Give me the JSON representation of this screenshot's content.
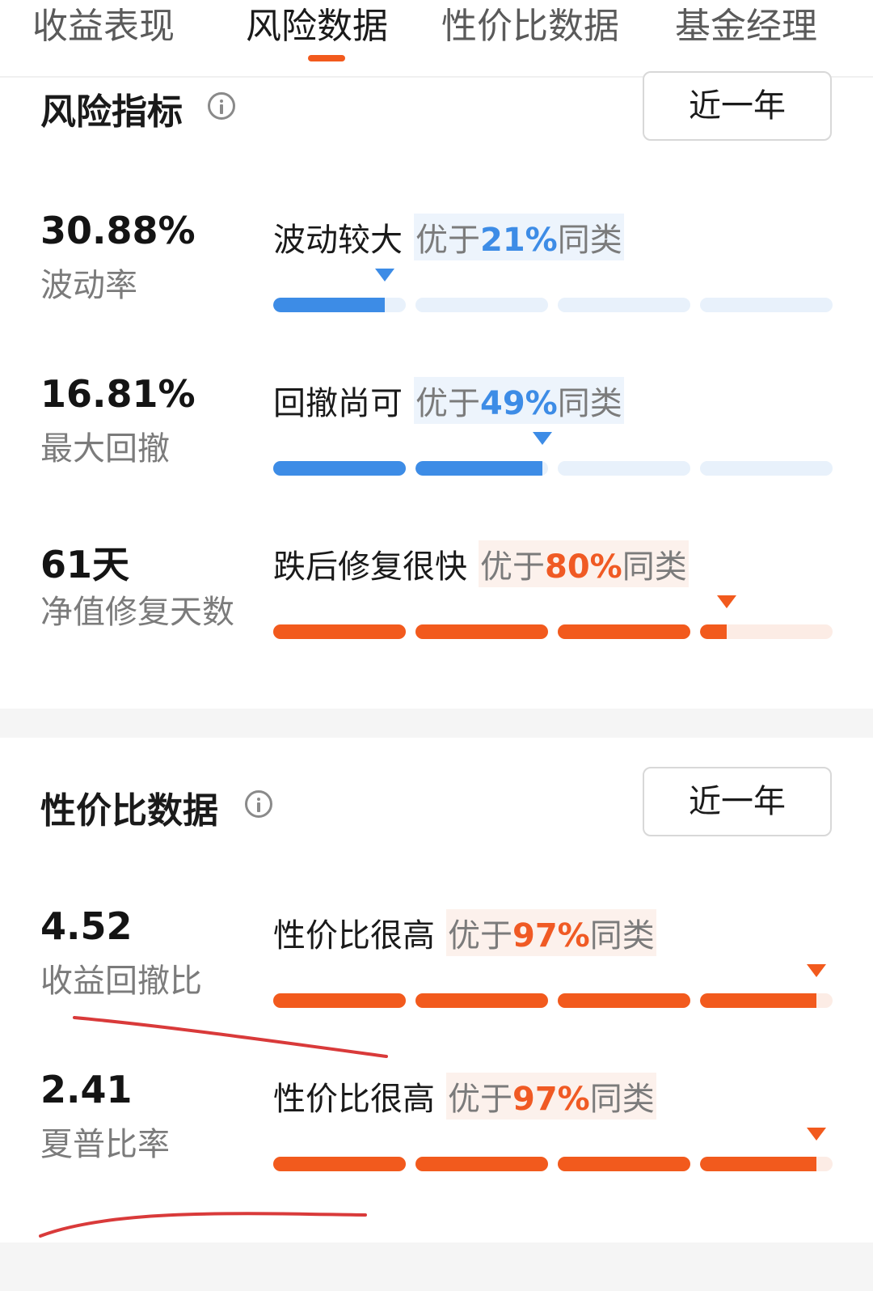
{
  "tabs": [
    {
      "label": "收益表现",
      "active": false
    },
    {
      "label": "风险数据",
      "active": true
    },
    {
      "label": "性价比数据",
      "active": false
    },
    {
      "label": "基金经理",
      "active": false
    }
  ],
  "colors": {
    "accent": "#f25a1d",
    "blue_fill": "#3d8ce6",
    "blue_track": "#e8f1fb",
    "orange_fill": "#f25a1d",
    "orange_track": "#fcece5",
    "annotation_red": "#d93a3a"
  },
  "risk": {
    "title": "风险指标",
    "info_icon": "info-circle-icon",
    "period": "近一年",
    "metrics": [
      {
        "value": "30.88%",
        "label": "波动率",
        "assessment": "波动较大",
        "rank_prefix": "优于",
        "rank_pct": "21%",
        "rank_suffix": "同类",
        "tone": "blue",
        "level": 0.21
      },
      {
        "value": "16.81%",
        "label": "最大回撤",
        "assessment": "回撤尚可",
        "rank_prefix": "优于",
        "rank_pct": "49%",
        "rank_suffix": "同类",
        "tone": "blue",
        "level": 0.49
      },
      {
        "value": "61天",
        "label": "净值修复天数",
        "assessment": "跌后修复很快",
        "rank_prefix": "优于",
        "rank_pct": "80%",
        "rank_suffix": "同类",
        "tone": "orange",
        "level": 0.8
      }
    ]
  },
  "value": {
    "title": "性价比数据",
    "info_icon": "info-circle-icon",
    "period": "近一年",
    "metrics": [
      {
        "value": "4.52",
        "label": "收益回撤比",
        "assessment": "性价比很高",
        "rank_prefix": "优于",
        "rank_pct": "97%",
        "rank_suffix": "同类",
        "tone": "orange",
        "level": 0.97
      },
      {
        "value": "2.41",
        "label": "夏普比率",
        "assessment": "性价比很高",
        "rank_prefix": "优于",
        "rank_pct": "97%",
        "rank_suffix": "同类",
        "tone": "orange",
        "level": 0.97
      }
    ]
  }
}
